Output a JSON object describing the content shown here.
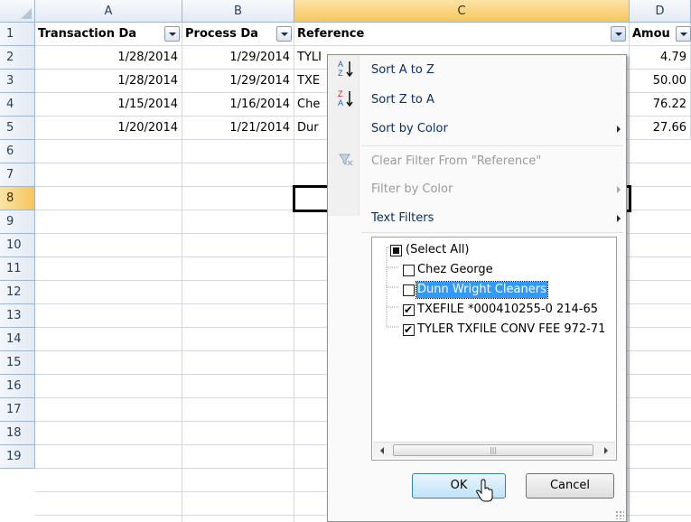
{
  "columns": [
    "A",
    "B",
    "C",
    "D"
  ],
  "rows": [
    "1",
    "2",
    "3",
    "4",
    "5",
    "6",
    "7",
    "8",
    "9",
    "10",
    "11",
    "12",
    "13",
    "14",
    "15",
    "16",
    "17",
    "18",
    "19"
  ],
  "headers": {
    "a": "Transaction Da",
    "b": "Process Da",
    "c": "Reference",
    "d": "Amou"
  },
  "data": [
    {
      "a": "1/28/2014",
      "b": "1/29/2014",
      "c": "TYLI",
      "d": "4.79"
    },
    {
      "a": "1/28/2014",
      "b": "1/29/2014",
      "c": "TXE",
      "d": "50.00"
    },
    {
      "a": "1/15/2014",
      "b": "1/16/2014",
      "c": "Che",
      "d": "76.22"
    },
    {
      "a": "1/20/2014",
      "b": "1/21/2014",
      "c": "Dur",
      "d": "27.66"
    }
  ],
  "menu": {
    "sort_az": "Sort A to Z",
    "sort_za": "Sort Z to A",
    "sort_color": "Sort by Color",
    "clear_filter": "Clear Filter From \"Reference\"",
    "filter_color": "Filter by Color",
    "text_filters": "Text Filters"
  },
  "filter_list": [
    {
      "label": "(Select All)",
      "state": "mixed"
    },
    {
      "label": "Chez George",
      "state": "off"
    },
    {
      "label": "Dunn Wright Cleaners",
      "state": "off",
      "highlighted": true
    },
    {
      "label": "TXEFILE *000410255-0  214-65",
      "state": "on"
    },
    {
      "label": "TYLER TXFILE CONV FEE 972-71",
      "state": "on"
    }
  ],
  "buttons": {
    "ok": "OK",
    "cancel": "Cancel"
  },
  "colors": {
    "header_selected": "#f6c65c",
    "highlight": "#3399ff",
    "menu_text": "#0b2f6a"
  }
}
